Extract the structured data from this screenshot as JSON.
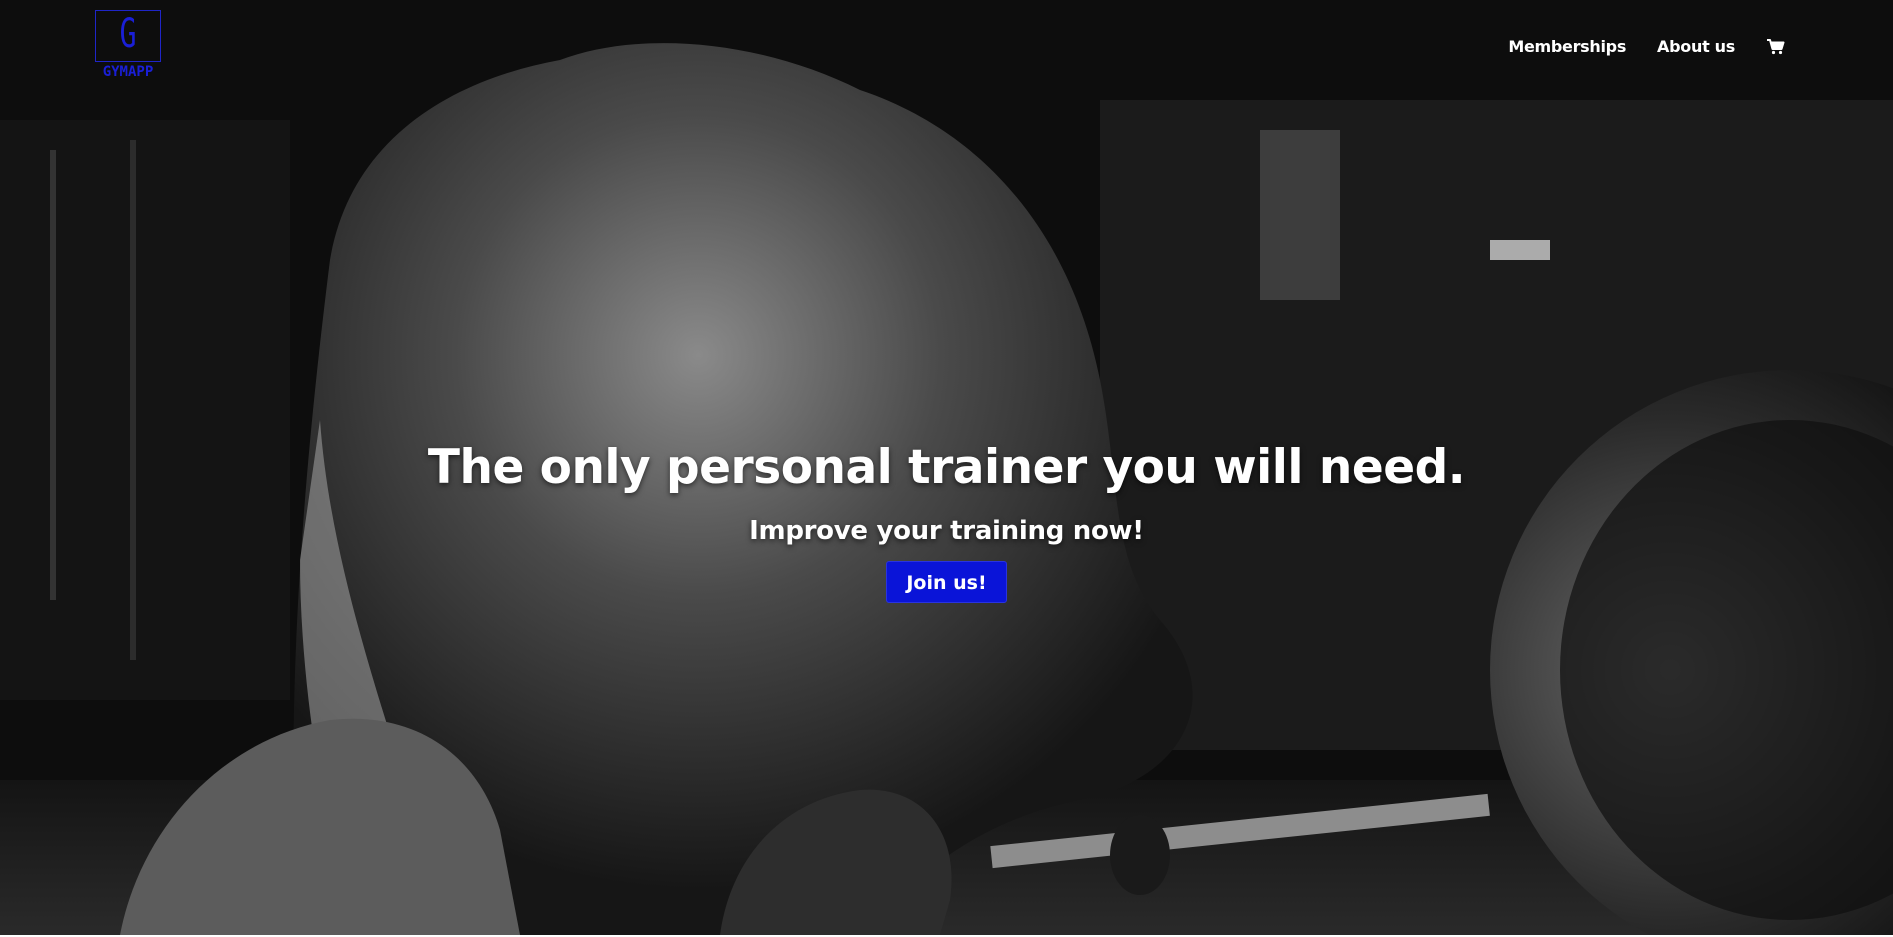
{
  "logo": {
    "letter": "G",
    "word": "GYMAPP"
  },
  "nav": {
    "items": [
      {
        "label": "Memberships"
      },
      {
        "label": "About us"
      }
    ],
    "cart_icon": "cart-icon"
  },
  "hero": {
    "headline": "The only personal trainer you will need.",
    "subheadline": "Improve your training now!",
    "cta_label": "Join us!",
    "background_image": "black-and-white photo of muscular athlete crouching in gym"
  },
  "colors": {
    "accent": "#0a14d8",
    "logo": "#1a1fd6",
    "text": "#ffffff",
    "background": "#0b0b0b"
  }
}
